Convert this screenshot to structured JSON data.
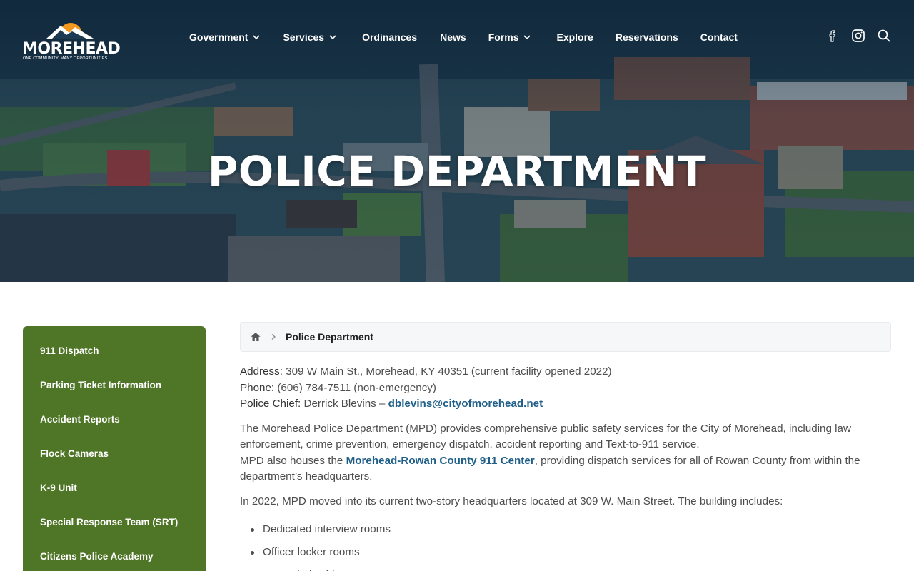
{
  "header": {
    "logo_word": "MOREHEAD",
    "logo_tagline": "ONE COMMUNITY. MANY OPPORTUNITIES.",
    "nav": [
      {
        "label": "Government",
        "dropdown": true
      },
      {
        "label": "Services",
        "dropdown": true
      },
      {
        "label": "Ordinances",
        "dropdown": false
      },
      {
        "label": "News",
        "dropdown": false
      },
      {
        "label": "Forms",
        "dropdown": true
      },
      {
        "label": "Explore",
        "dropdown": false
      },
      {
        "label": "Reservations",
        "dropdown": false
      },
      {
        "label": "Contact",
        "dropdown": false
      }
    ],
    "social_icons": [
      "facebook-icon",
      "instagram-icon",
      "search-icon"
    ]
  },
  "hero": {
    "title": "POLICE DEPARTMENT"
  },
  "sidebar": {
    "items": [
      {
        "label": "911 Dispatch"
      },
      {
        "label": "Parking Ticket Information"
      },
      {
        "label": "Accident Reports"
      },
      {
        "label": "Flock Cameras"
      },
      {
        "label": "K-9 Unit"
      },
      {
        "label": "Special Response Team (SRT)"
      },
      {
        "label": "Citizens Police Academy"
      }
    ]
  },
  "breadcrumb": {
    "current": "Police Department"
  },
  "content": {
    "address_label": "Address:",
    "address_value": " 309 W Main St., Morehead, KY 40351 (current facility opened 2022)",
    "phone_label": "Phone:",
    "phone_value": " (606) 784-7511 (non-emergency)",
    "chief_label": "Police Chief:",
    "chief_value": " Derrick Blevins – ",
    "chief_email": "dblevins@cityofmorehead.net",
    "para1": "The Morehead Police Department (MPD) provides comprehensive public safety services for the City of Morehead, including law enforcement, crime prevention, emergency dispatch, accident reporting and Text-to-911 service.",
    "para2_pre": "MPD also houses the ",
    "para2_link": "Morehead-Rowan County 911 Center",
    "para2_post": ", providing dispatch services for all of Rowan County from within the department’s headquarters.",
    "para3": "In 2022, MPD moved into its current two-story headquarters located at 309 W. Main Street. The building includes:",
    "features": [
      "Dedicated interview rooms",
      "Officer locker rooms",
      "Expanded evidence storage"
    ]
  },
  "colors": {
    "sidebar_bg": "#4f7527",
    "link": "#1f5f88",
    "logo_sun": "#f39a1e"
  }
}
